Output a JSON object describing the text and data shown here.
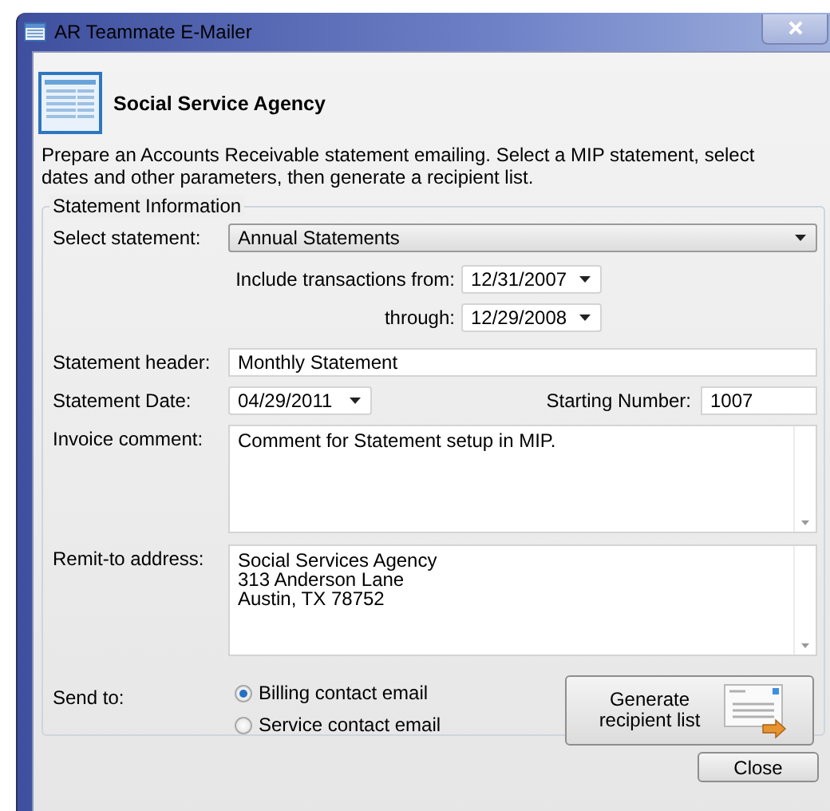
{
  "window": {
    "title": "AR Teammate E-Mailer"
  },
  "header": {
    "title": "Social Service Agency",
    "description": "Prepare an Accounts Receivable statement emailing. Select a MIP statement, select dates and other parameters, then generate a recipient list."
  },
  "group": {
    "title": "Statement Information"
  },
  "select_statement": {
    "label": "Select statement:",
    "value": "Annual Statements"
  },
  "transactions_from": {
    "label": "Include transactions from:",
    "value": "12/31/2007"
  },
  "transactions_through": {
    "label": "through:",
    "value": "12/29/2008"
  },
  "statement_header": {
    "label": "Statement header:",
    "value": "Monthly Statement"
  },
  "statement_date": {
    "label": "Statement Date:",
    "value": "04/29/2011"
  },
  "starting_number": {
    "label": "Starting Number:",
    "value": "1007"
  },
  "invoice_comment": {
    "label": "Invoice comment:",
    "value": "Comment for Statement setup in MIP."
  },
  "remit_to": {
    "label": "Remit-to address:",
    "value": "Social Services Agency\n313 Anderson Lane\nAustin, TX 78752"
  },
  "send_to": {
    "label": "Send to:",
    "options": [
      {
        "label": "Billing contact email",
        "selected": true
      },
      {
        "label": "Service contact email",
        "selected": false
      }
    ]
  },
  "buttons": {
    "generate": "Generate recipient list",
    "close": "Close"
  }
}
